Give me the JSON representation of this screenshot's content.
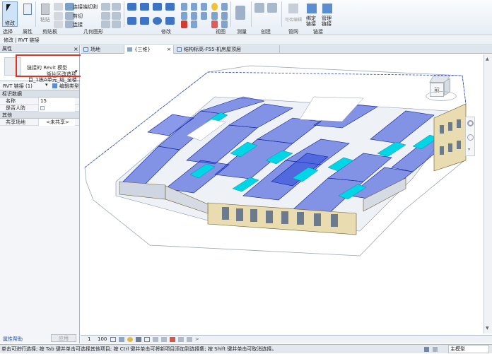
{
  "ribbon": {
    "modify_label": "修改",
    "groups": {
      "select": "选择",
      "properties": "属性",
      "clipboard": "剪贴板",
      "geometry": "几何图形",
      "modify": "修改",
      "view": "视图",
      "measure": "测量",
      "create": "创建",
      "manage_links": "管网",
      "link": "链接"
    },
    "small_buttons": {
      "cope": "连接端切割",
      "cut": "剪切",
      "join": "连接",
      "paste": "粘贴",
      "bind_link": "绑定\n链接",
      "manage_links": "管理\n链接",
      "rel_cut": "可否编辑"
    }
  },
  "context_bar": {
    "text": "修改 | RVT 链接"
  },
  "properties": {
    "header": "属性",
    "type_family": "链接的 Revit 模型",
    "type_name_line1": "街片区改造项",
    "type_name_line2": "目_1栋A单元_结_全楼...",
    "selector": "RVT 链接 (1)",
    "edit_type": "编辑类型",
    "group_identity": "标识数据",
    "name_label": "名称",
    "name_value": "15",
    "shelter_label": "是否人防",
    "group_other": "其他",
    "shared_site_label": "共享场地",
    "shared_site_value": "<未共享>",
    "help_link": "属性帮助",
    "apply_button": "应用"
  },
  "tabs": [
    {
      "label": "场地"
    },
    {
      "label": "{三维}"
    },
    {
      "label": "结构标高-F55-机房屋顶层"
    }
  ],
  "viewbar": {
    "scale_prefix": "1",
    "scale": "100"
  },
  "status": {
    "message": "单击可进行选择; 按 Tab 键并单击可选择其他项目; 按 Ctrl 键并单击可将新项目添加到选择集; 按 Shift 键并单击可取消选择。",
    "main_model": "主模型"
  },
  "viewcube": {
    "face": "前"
  },
  "colors": {
    "accent_blue": "#1f3fd6",
    "cyan": "#00d6e6",
    "highlight_red": "#e0301e"
  }
}
